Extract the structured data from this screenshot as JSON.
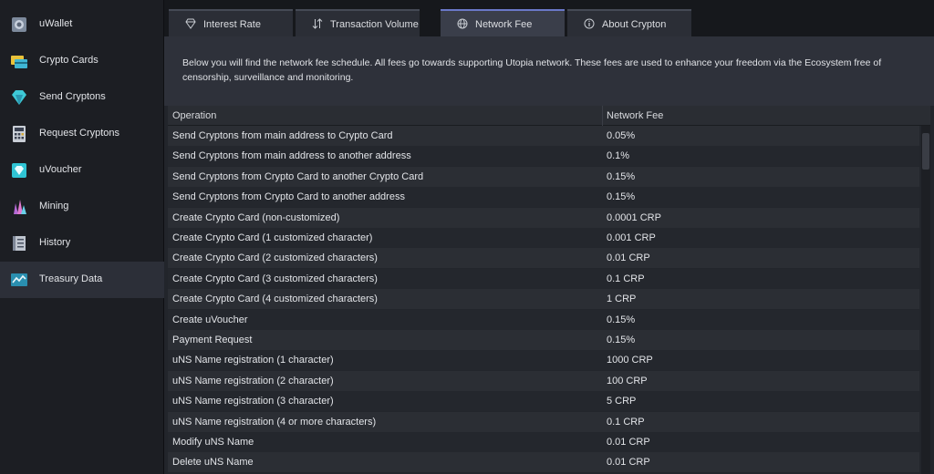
{
  "sidebar": {
    "items": [
      {
        "label": "uWallet",
        "icon": "wallet-icon"
      },
      {
        "label": "Crypto Cards",
        "icon": "crypto-cards-icon"
      },
      {
        "label": "Send Cryptons",
        "icon": "send-cryptons-icon"
      },
      {
        "label": "Request Cryptons",
        "icon": "calculator-icon"
      },
      {
        "label": "uVoucher",
        "icon": "voucher-icon"
      },
      {
        "label": "Mining",
        "icon": "mining-crystals-icon"
      },
      {
        "label": "History",
        "icon": "history-ledger-icon"
      },
      {
        "label": "Treasury Data",
        "icon": "treasury-chart-icon"
      }
    ],
    "active_index": 7
  },
  "tabs": [
    {
      "label": "Interest Rate",
      "icon": "diamond-icon"
    },
    {
      "label": "Transaction Volume",
      "icon": "up-down-arrows-icon"
    },
    {
      "label": "Network Fee",
      "icon": "globe-icon"
    },
    {
      "label": "About Crypton",
      "icon": "info-icon"
    }
  ],
  "active_tab": 2,
  "intro": "Below you will find the network fee schedule. All fees go towards supporting Utopia network. These fees are used to enhance your freedom via the Ecosystem free of censorship, surveillance and monitoring.",
  "table": {
    "columns": [
      "Operation",
      "Network Fee"
    ],
    "rows": [
      [
        "Send Cryptons from main address to Crypto Card",
        "0.05%"
      ],
      [
        "Send Cryptons from main address to another address",
        "0.1%"
      ],
      [
        "Send Cryptons from Crypto Card to another Crypto Card",
        "0.15%"
      ],
      [
        "Send Cryptons from Crypto Card to another address",
        "0.15%"
      ],
      [
        "Create Crypto Card (non-customized)",
        "0.0001 CRP"
      ],
      [
        "Create Crypto Card (1 customized character)",
        "0.001 CRP"
      ],
      [
        "Create Crypto Card (2 customized characters)",
        "0.01 CRP"
      ],
      [
        "Create Crypto Card (3 customized characters)",
        "0.1 CRP"
      ],
      [
        "Create Crypto Card (4 customized characters)",
        "1 CRP"
      ],
      [
        "Create uVoucher",
        "0.15%"
      ],
      [
        "Payment Request",
        "0.15%"
      ],
      [
        "uNS Name registration (1 character)",
        "1000 CRP"
      ],
      [
        "uNS Name registration (2 character)",
        "100 CRP"
      ],
      [
        "uNS Name registration (3 character)",
        "5 CRP"
      ],
      [
        "uNS Name registration (4 or more characters)",
        "0.1 CRP"
      ],
      [
        "Modify uNS Name",
        "0.01 CRP"
      ],
      [
        "Delete uNS Name",
        "0.01 CRP"
      ]
    ]
  },
  "colors": {
    "active_tab_accent": "#6a78c8",
    "sidebar_active": "#2c2f38"
  }
}
